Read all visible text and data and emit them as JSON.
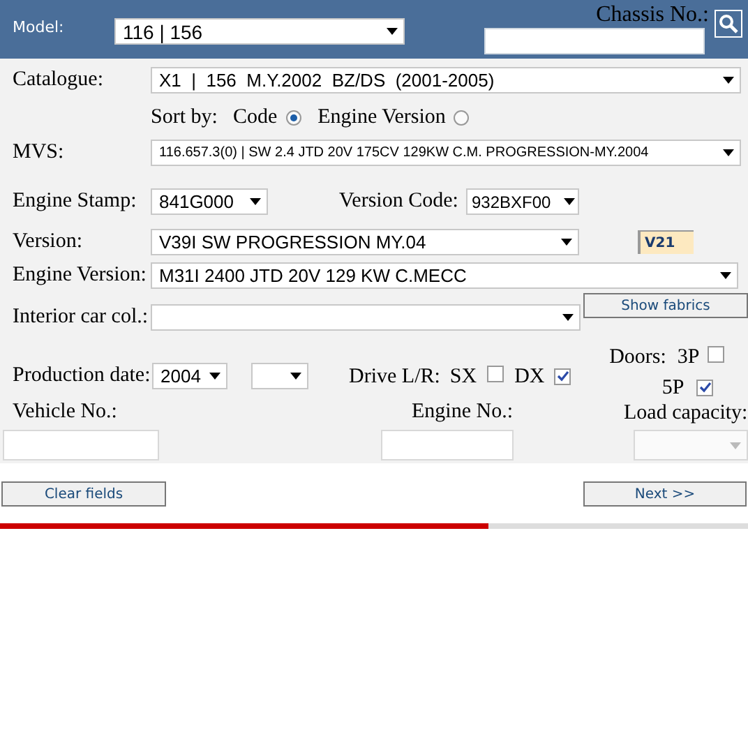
{
  "header": {
    "model_label": "Model:",
    "model_value": "116 | 156",
    "chassis_label": "Chassis No.:"
  },
  "catalogue": {
    "label": "Catalogue:",
    "value": "X1  |  156  M.Y.2002  BZ/DS  (2001-2005)"
  },
  "sort_by": {
    "label": "Sort by:",
    "options": [
      {
        "label": "Code",
        "selected": true
      },
      {
        "label": "Engine Version",
        "selected": false
      }
    ]
  },
  "mvs": {
    "label": "MVS:",
    "value": "116.657.3(0) | SW 2.4 JTD 20V 175CV 129KW C.M. PROGRESSION-MY.2004"
  },
  "engine_stamp": {
    "label": "Engine Stamp:",
    "value": "841G000"
  },
  "version_code": {
    "label": "Version Code:",
    "value": "932BXF00"
  },
  "version": {
    "label": "Version:",
    "value": "V39I SW PROGRESSION MY.04",
    "tag": "V21"
  },
  "engine_version": {
    "label": "Engine Version:",
    "value": "M31I 2400 JTD 20V 129 KW C.MECC"
  },
  "interior": {
    "label": "Interior car col.:",
    "button": "Show fabrics"
  },
  "production_date": {
    "label": "Production date:",
    "year": "2004"
  },
  "drive": {
    "label": "Drive L/R:",
    "options": [
      {
        "label": "SX",
        "checked": false
      },
      {
        "label": "DX",
        "checked": true
      }
    ]
  },
  "doors": {
    "label": "Doors:",
    "options": [
      {
        "label": "3P",
        "checked": false
      },
      {
        "label": "5P",
        "checked": true
      }
    ]
  },
  "vehicle_no": {
    "label": "Vehicle No.:"
  },
  "engine_no": {
    "label": "Engine No.:"
  },
  "load_capacity": {
    "label": "Load capacity:",
    "disabled": true
  },
  "buttons": {
    "clear": "Clear fields",
    "next": "Next >>"
  },
  "progress": {
    "level": 0.653
  }
}
